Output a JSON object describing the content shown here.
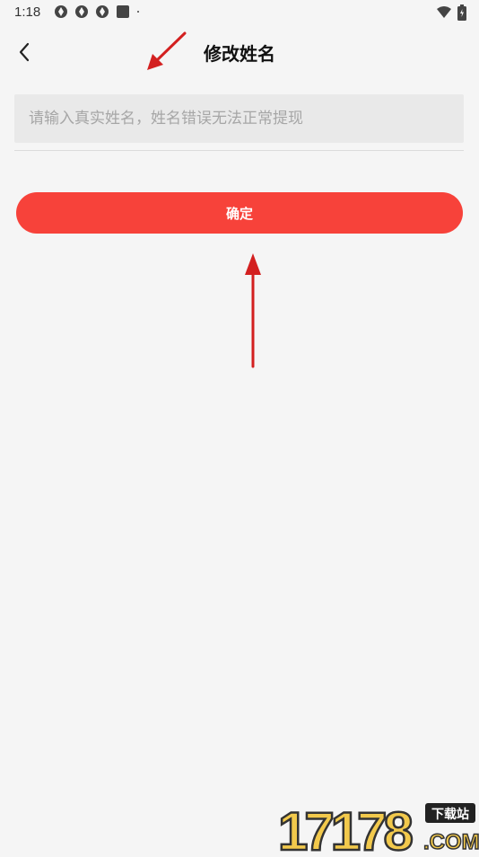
{
  "status_bar": {
    "time": "1:18",
    "left_icons": [
      "app-icon",
      "app-icon",
      "app-icon",
      "square-icon",
      "dot-icon"
    ],
    "right_icons": [
      "wifi-icon",
      "battery-icon"
    ]
  },
  "header": {
    "back_icon": "chevron-left-icon",
    "title": "修改姓名"
  },
  "form": {
    "name_placeholder": "请输入真实姓名，姓名错误无法正常提现",
    "name_value": ""
  },
  "actions": {
    "confirm_label": "确定",
    "confirm_color": "#f7423a"
  },
  "watermark": {
    "main": "17178",
    "badge": "下载站",
    "domain": ".COM"
  }
}
